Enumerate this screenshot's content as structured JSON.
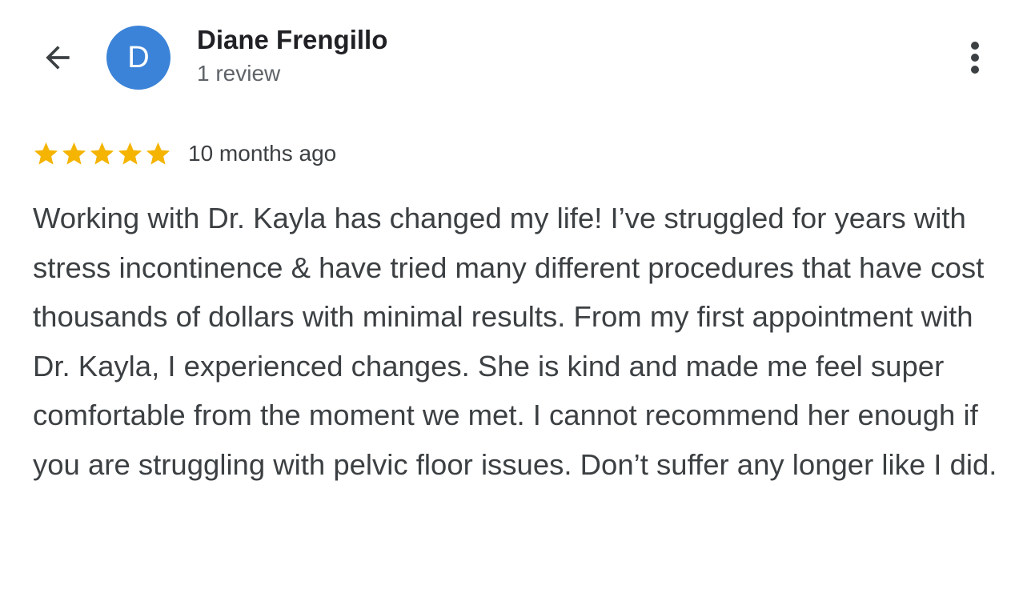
{
  "header": {
    "back_icon": "arrow-left-icon",
    "avatar_letter": "D",
    "avatar_color": "#3b83d8",
    "user_name": "Diane Frengillo",
    "review_count": "1 review",
    "more_icon": "more-vert-icon"
  },
  "review": {
    "rating": 5,
    "rating_max": 5,
    "star_color": "#f4b400",
    "time_ago": "10 months ago",
    "text": "Working with Dr. Kayla has changed my life! I’ve struggled for years with stress incontinence & have tried many different procedures that have cost thousands of dollars with minimal results. From my first appointment with Dr. Kayla, I experienced changes. She is kind and made me feel super comfortable from the moment we met. I cannot recommend her enough if you are struggling with pelvic floor issues. Don’t suffer any longer like I did."
  }
}
